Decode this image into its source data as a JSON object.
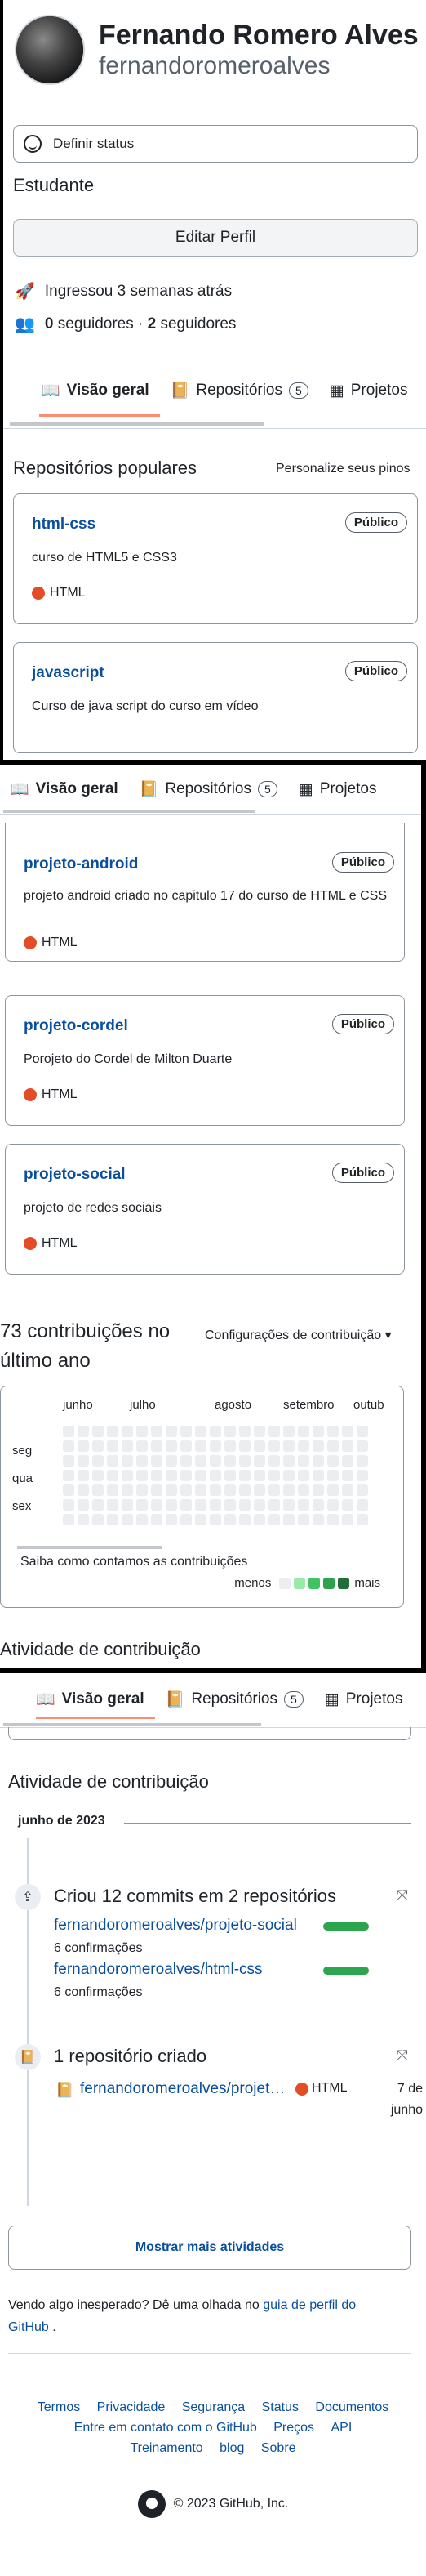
{
  "profile": {
    "full_name": "Fernando Romero Alves",
    "login": "fernandoromeroalves",
    "status_label": "Definir status",
    "bio": "Estudante",
    "edit_label": "Editar Perfil",
    "joined": "Ingressou 3 semanas atrás",
    "followers_count": "0",
    "followers_label": "seguidores",
    "following_count": "2",
    "following_label": "seguidores",
    "separator": "·"
  },
  "tabs": {
    "overview": "Visão geral",
    "repositories": "Repositórios",
    "repositories_count": "5",
    "projects": "Projetos"
  },
  "popular": {
    "title": "Repositórios populares",
    "customize": "Personalize seus pinos",
    "repos": [
      {
        "name": "html-css",
        "visibility": "Público",
        "description": "curso de HTML5 e CSS3",
        "language": "HTML"
      },
      {
        "name": "javascript",
        "visibility": "Público",
        "description": "Curso de java script do curso em vídeo",
        "language": ""
      },
      {
        "name": "projeto-android",
        "visibility": "Público",
        "description": "projeto android criado no capitulo 17 do curso de HTML e CSS",
        "language": "HTML"
      },
      {
        "name": "projeto-cordel",
        "visibility": "Público",
        "description": "Porojeto do Cordel de Milton Duarte",
        "language": "HTML"
      },
      {
        "name": "projeto-social",
        "visibility": "Público",
        "description": "projeto de redes sociais",
        "language": "HTML"
      }
    ]
  },
  "contributions": {
    "title": "73 contribuições no último ano",
    "settings": "Configurações de contribuição",
    "months": [
      "junho",
      "julho",
      "agosto",
      "setembro",
      "outub"
    ],
    "days": [
      "seg",
      "qua",
      "sex"
    ],
    "help": "Saiba como contamos as contribuições",
    "less": "menos",
    "more": "mais",
    "legend_colors": [
      "#ebedf0",
      "#9be9a8",
      "#40c463",
      "#30a14e",
      "#216e39"
    ]
  },
  "activity": {
    "title": "Atividade de contribuição",
    "month": "junho de 2023",
    "commits": {
      "heading": "Criou 12 commits em 2 repositórios",
      "items": [
        {
          "repo": "fernandoromeroalves/projeto-social",
          "count": "6 confirmações"
        },
        {
          "repo": "fernandoromeroalves/html-css",
          "count": "6 confirmações"
        }
      ]
    },
    "created": {
      "heading": "1 repositório criado",
      "repo": "fernandoromeroalves/projeto-social",
      "language": "HTML",
      "date": "7 de junho"
    },
    "more_button": "Mostrar mais atividades",
    "note_prefix": "Vendo algo inesperado? Dê uma olhada no",
    "note_link": "guia de perfil do GitHub",
    "note_suffix": "."
  },
  "footer": {
    "links_row1": [
      "Termos",
      "Privacidade",
      "Segurança",
      "Status",
      "Documentos"
    ],
    "links_row2": [
      "Entre em contato com o GitHub",
      "Preços",
      "API"
    ],
    "links_row3": [
      "Treinamento",
      "blog",
      "Sobre"
    ],
    "copyright": "© 2023 GitHub, Inc."
  }
}
